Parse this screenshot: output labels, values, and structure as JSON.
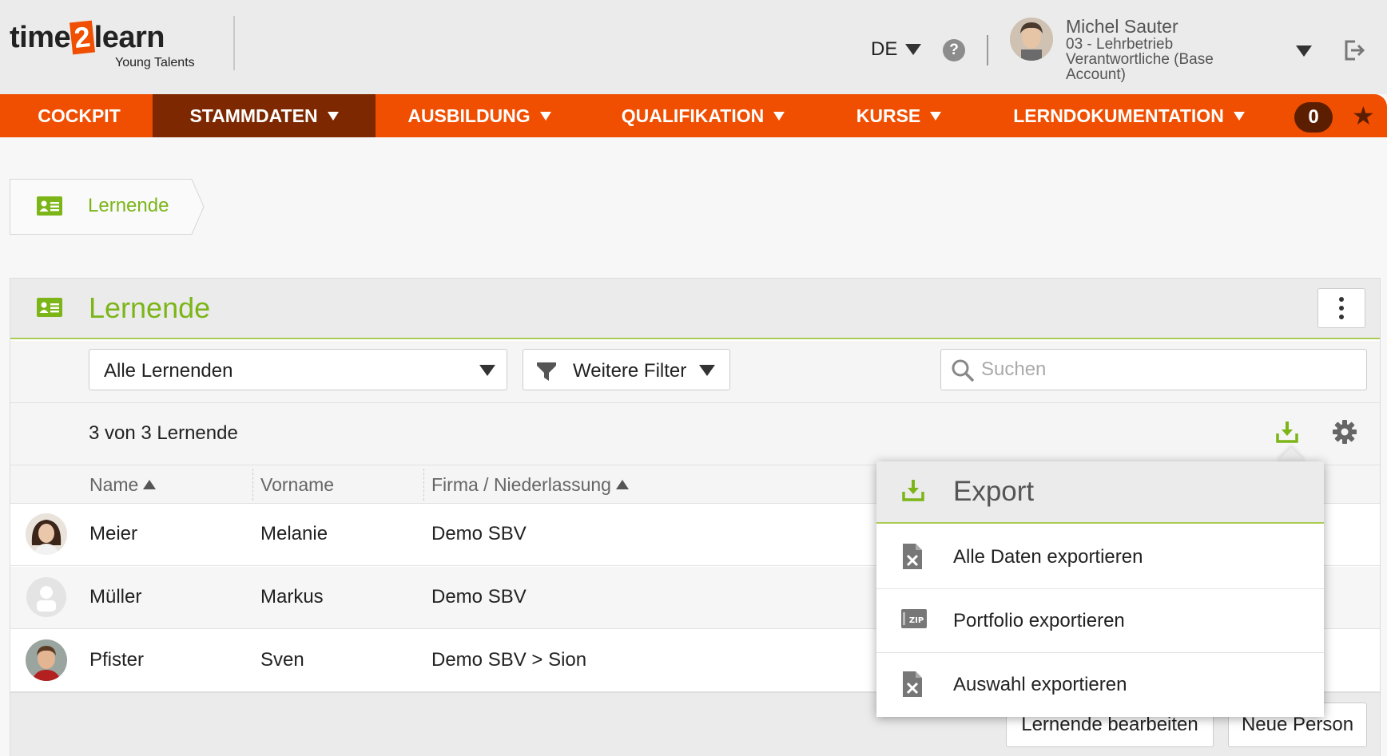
{
  "header": {
    "logo_prefix": "time",
    "logo_box": "2",
    "logo_suffix": "learn",
    "logo_sub": "Young Talents",
    "language": "DE",
    "help_icon": "question-icon",
    "user": {
      "name": "Michel Sauter",
      "role": "03 - Lehrbetrieb Verantwortliche (Base Account)"
    }
  },
  "nav": {
    "items": [
      {
        "label": "COCKPIT",
        "dropdown": false,
        "active": false
      },
      {
        "label": "STAMMDATEN",
        "dropdown": true,
        "active": true
      },
      {
        "label": "AUSBILDUNG",
        "dropdown": true,
        "active": false
      },
      {
        "label": "QUALIFIKATION",
        "dropdown": true,
        "active": false
      },
      {
        "label": "KURSE",
        "dropdown": true,
        "active": false
      },
      {
        "label": "LERNDOKUMENTATION",
        "dropdown": true,
        "active": false
      }
    ],
    "badge": "0",
    "star_icon": "star-icon"
  },
  "breadcrumb": {
    "label": "Lernende"
  },
  "panel": {
    "title": "Lernende",
    "filter_select": "Alle Lernenden",
    "more_filter": "Weitere Filter",
    "search_placeholder": "Suchen",
    "count": "3 von 3 Lernende",
    "columns": {
      "name": "Name",
      "vorname": "Vorname",
      "firma": "Firma / Niederlassung"
    },
    "rows": [
      {
        "name": "Meier",
        "vorname": "Melanie",
        "firma": "Demo SBV"
      },
      {
        "name": "Müller",
        "vorname": "Markus",
        "firma": "Demo SBV"
      },
      {
        "name": "Pfister",
        "vorname": "Sven",
        "firma": "Demo SBV > Sion"
      }
    ],
    "buttons": {
      "edit": "Lernende bearbeiten",
      "new": "Neue Person"
    }
  },
  "export_popover": {
    "title": "Export",
    "items": [
      {
        "label": "Alle Daten exportieren",
        "icon": "excel-file-icon"
      },
      {
        "label": "Portfolio exportieren",
        "icon": "zip-file-icon"
      },
      {
        "label": "Auswahl exportieren",
        "icon": "excel-file-icon"
      }
    ]
  },
  "colors": {
    "brand_orange": "#f04e00",
    "nav_active": "#7d2800",
    "accent_green": "#7cb518"
  }
}
